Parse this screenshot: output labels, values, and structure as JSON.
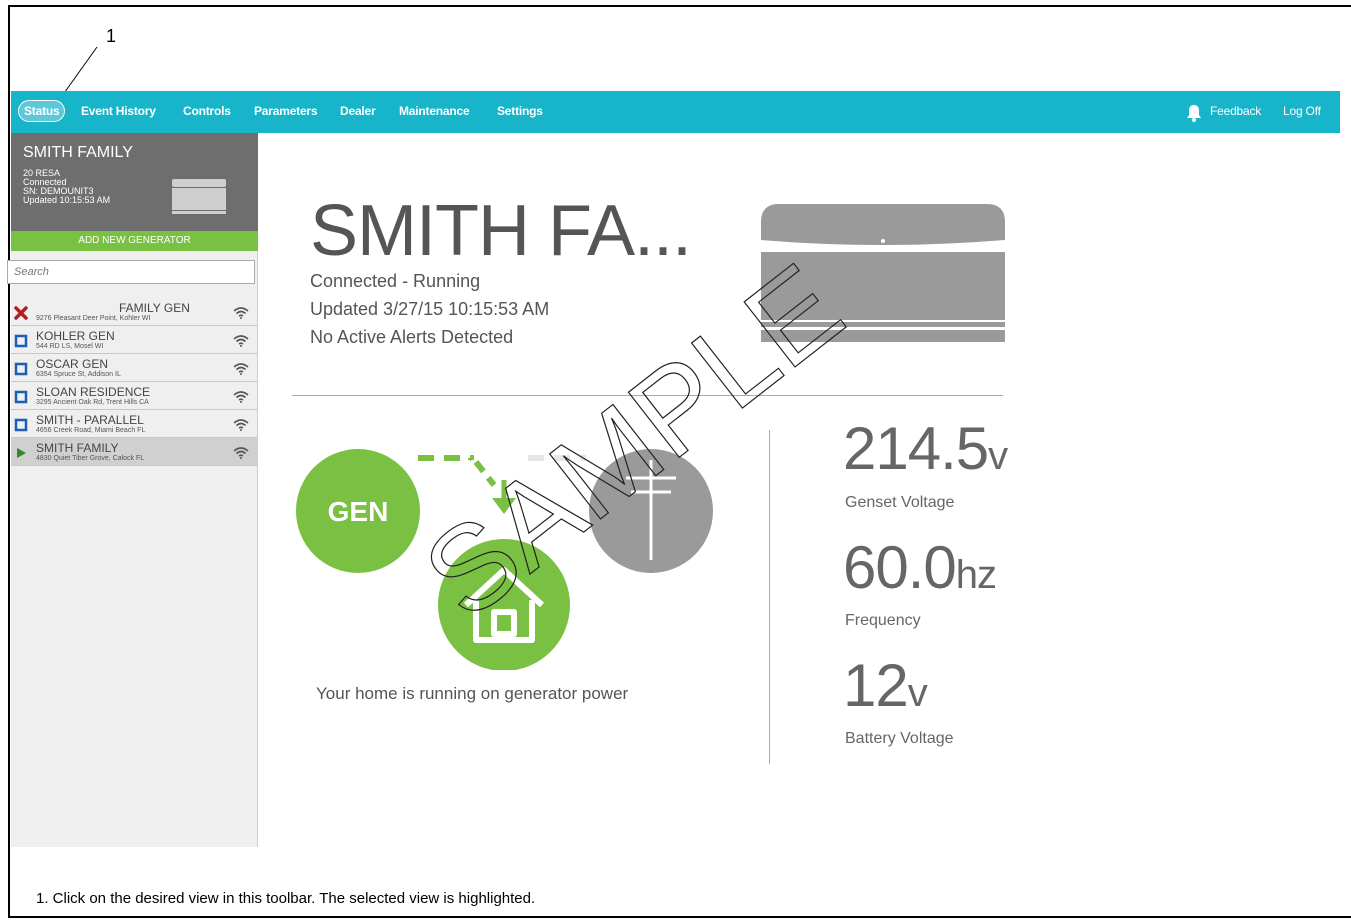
{
  "callout": {
    "number": "1"
  },
  "nav": {
    "items": [
      "Status",
      "Event History",
      "Controls",
      "Parameters",
      "Dealer",
      "Maintenance",
      "Settings"
    ],
    "active": "Status",
    "feedback": "Feedback",
    "logoff": "Log Off"
  },
  "sidebar": {
    "title": "SMITH FAMILY",
    "info": [
      "20 RESA",
      "Connected",
      "SN: DEMOUNIT3",
      "Updated 10:15:53 AM"
    ],
    "add_button": "ADD NEW GENERATOR",
    "search_placeholder": "Search",
    "generators": [
      {
        "name": "FAMILY GEN",
        "address": "9276 Pleasant Deer Point, Kohler WI",
        "status": "error"
      },
      {
        "name": "KOHLER GEN",
        "address": "544 RD LS, Mosel WI",
        "status": "stopped"
      },
      {
        "name": "OSCAR GEN",
        "address": "6354 Spruce St, Addison IL",
        "status": "stopped"
      },
      {
        "name": "SLOAN RESIDENCE",
        "address": "3295 Ancient Oak Rd, Trent Hills CA",
        "status": "stopped"
      },
      {
        "name": "SMITH - PARALLEL",
        "address": "4656 Creek Road, Miami Beach FL",
        "status": "stopped"
      },
      {
        "name": "SMITH FAMILY",
        "address": "4830 Quiet Tiber Grove, Calock FL",
        "status": "running"
      }
    ]
  },
  "main": {
    "title": "SMITH FA...",
    "status": "Connected - Running",
    "updated": "Updated 3/27/15 10:15:53 AM",
    "alerts": "No Active Alerts Detected",
    "gen_label": "GEN",
    "caption": "Your home is running on generator power"
  },
  "metrics": [
    {
      "value": "214.5",
      "unit": "v",
      "label": "Genset Voltage"
    },
    {
      "value": "60.0",
      "unit": "hz",
      "label": "Frequency"
    },
    {
      "value": "12",
      "unit": "v",
      "label": "Battery Voltage"
    }
  ],
  "watermark": "SAMPLE",
  "footnote": "1.  Click on the desired view in this toolbar.  The selected view is highlighted.",
  "colors": {
    "nav": "#18b4c9",
    "green": "#7ac043",
    "sidebar_head": "#6e6e6e",
    "error": "#b01e1e",
    "stopped": "#1a5fb4"
  }
}
